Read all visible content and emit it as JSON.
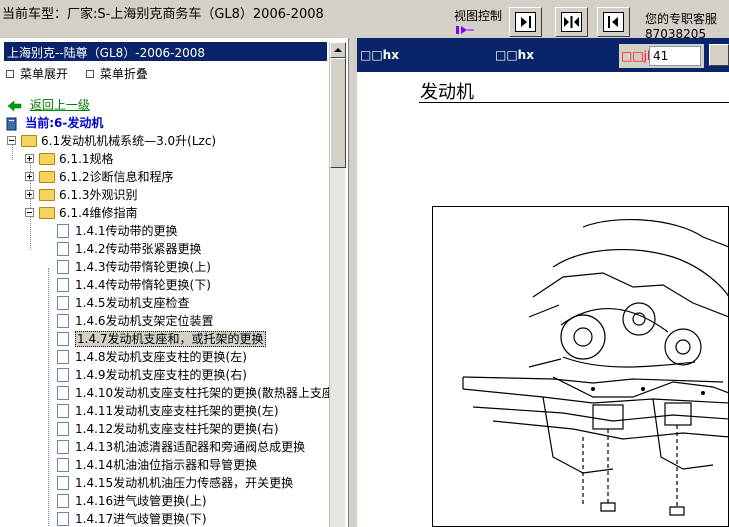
{
  "header": {
    "vehicle_label": "当前车型：厂家:S-上海别克商务车（GL8）2006-2008",
    "view_control_label": "视图控制",
    "support_label": "您的专职客服",
    "support_phone": "87038205"
  },
  "left": {
    "model_title": "上海别克--陆尊（GL8）-2006-2008",
    "menu_expand": "菜单展开",
    "menu_collapse": "菜单折叠",
    "back_link": "返回上一级",
    "current_label": "当前:6-发动机",
    "tree": {
      "root": "6.1发动机机械系统—3.0升(Lzc)",
      "folders": [
        "6.1.1规格",
        "6.1.2诊断信息和程序",
        "6.1.3外观识别",
        "6.1.4维修指南"
      ],
      "items": [
        "1.4.1传动带的更换",
        "1.4.2传动带张紧器更换",
        "1.4.3传动带惰轮更换(上)",
        "1.4.4传动带惰轮更换(下)",
        "1.4.5发动机支座检查",
        "1.4.6发动机支架定位装置",
        "1.4.7发动机支座和，或托架的更换",
        "1.4.8发动机支座支柱的更换(左)",
        "1.4.9发动机支座支柱的更换(右)",
        "1.4.10发动机支座支柱托架的更换(散热器上支座",
        "1.4.11发动机支座支柱托架的更换(左)",
        "1.4.12发动机支座支柱托架的更换(右)",
        "1.4.13机油滤清器适配器和旁通阀总成更换",
        "1.4.14机油油位指示器和导管更换",
        "1.4.15发动机机油压力传感器，开关更换",
        "1.4.16进气歧管更换(上)",
        "1.4.17进气歧管更换(下)"
      ],
      "selected_index": 6
    }
  },
  "right": {
    "bar_left": "□□hx",
    "bar_mid": "□□hx",
    "page_label": "□□jl",
    "page_value": "41",
    "doc_title": "发动机"
  },
  "colors": {
    "titlebar_bg": "#0a246a",
    "window_bg": "#d4d0c8",
    "back_link": "#008000",
    "current_label": "#0000cc",
    "page_label": "#ff0000"
  }
}
